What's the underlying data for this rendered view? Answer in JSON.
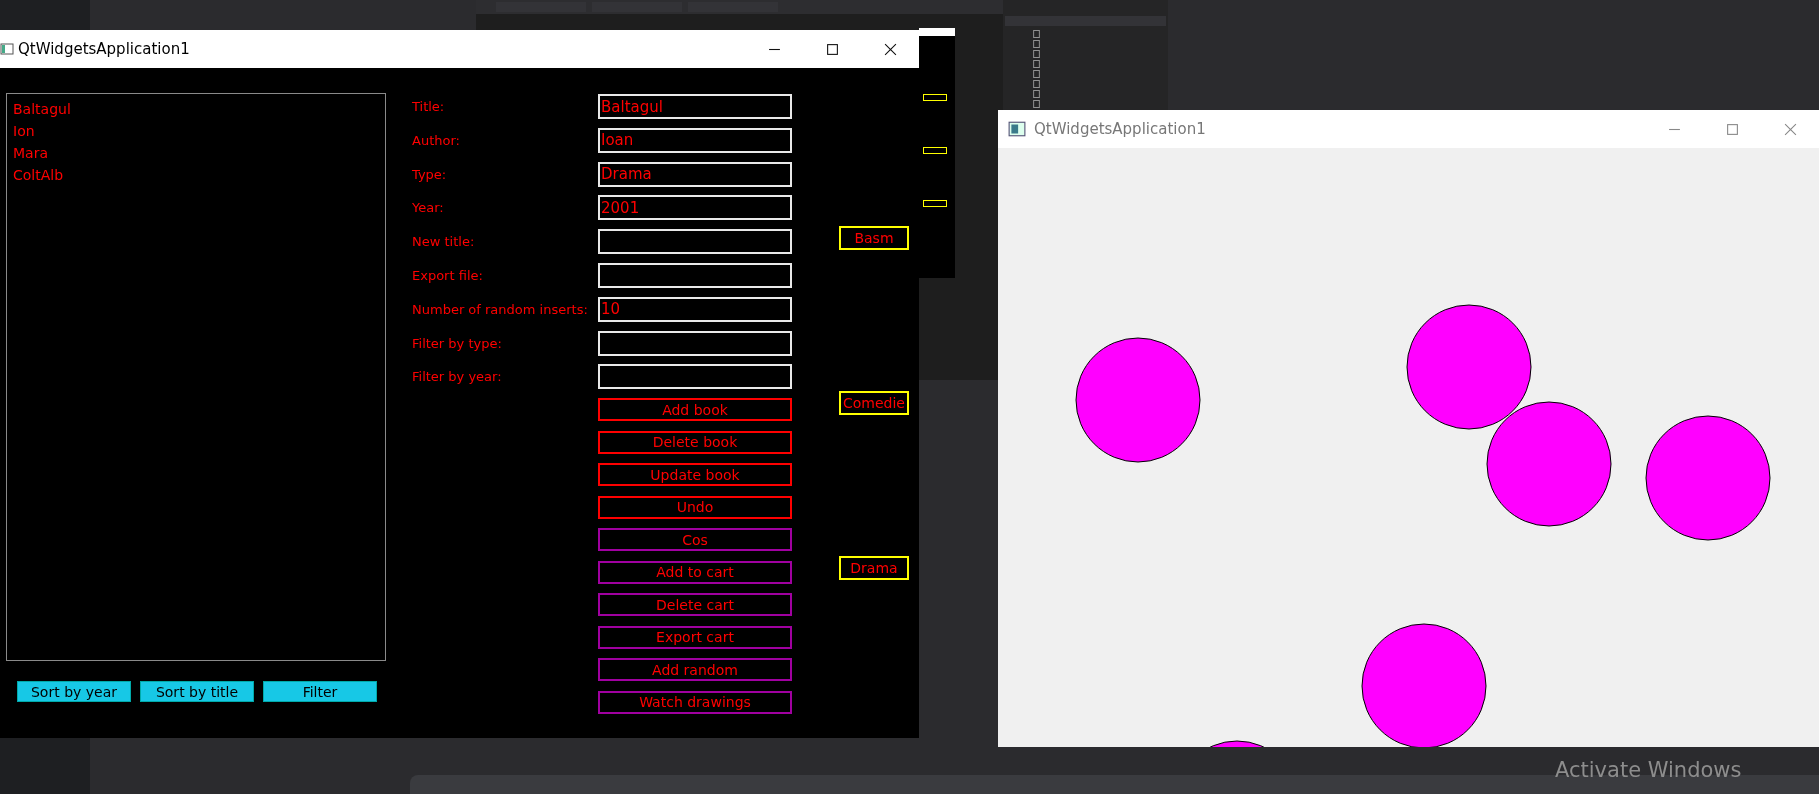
{
  "book_window": {
    "title": "QtWidgetsApplication1",
    "books": [
      "Baltagul",
      "Ion",
      "Mara",
      "ColtAlb"
    ],
    "fields": [
      {
        "label": "Title:",
        "value": "Baltagul"
      },
      {
        "label": "Author:",
        "value": "Ioan"
      },
      {
        "label": "Type:",
        "value": "Drama"
      },
      {
        "label": "Year:",
        "value": "2001"
      },
      {
        "label": "New title:"
      },
      {
        "label": "Export file:"
      },
      {
        "label": "Number of random inserts:",
        "value": "10"
      },
      {
        "label": "Filter by type:"
      },
      {
        "label": "Filter by year:"
      }
    ],
    "actions": [
      {
        "label": "Add book",
        "kind": "book"
      },
      {
        "label": "Delete book",
        "kind": "book"
      },
      {
        "label": "Update book",
        "kind": "book"
      },
      {
        "label": "Undo",
        "kind": "book"
      },
      {
        "label": "Cos",
        "kind": "cart"
      },
      {
        "label": "Add to cart",
        "kind": "cart"
      },
      {
        "label": "Delete cart",
        "kind": "cart"
      },
      {
        "label": "Export cart",
        "kind": "cart"
      },
      {
        "label": "Add random",
        "kind": "cart"
      },
      {
        "label": "Watch drawings",
        "kind": "cart"
      }
    ],
    "type_buttons": [
      "Basm",
      "Comedie",
      "Drama"
    ],
    "sort_buttons": [
      "Sort by year",
      "Sort by title",
      "Filter"
    ]
  },
  "drawing_window": {
    "title": "QtWidgetsApplication1"
  },
  "system_notice": "Activate Windows"
}
